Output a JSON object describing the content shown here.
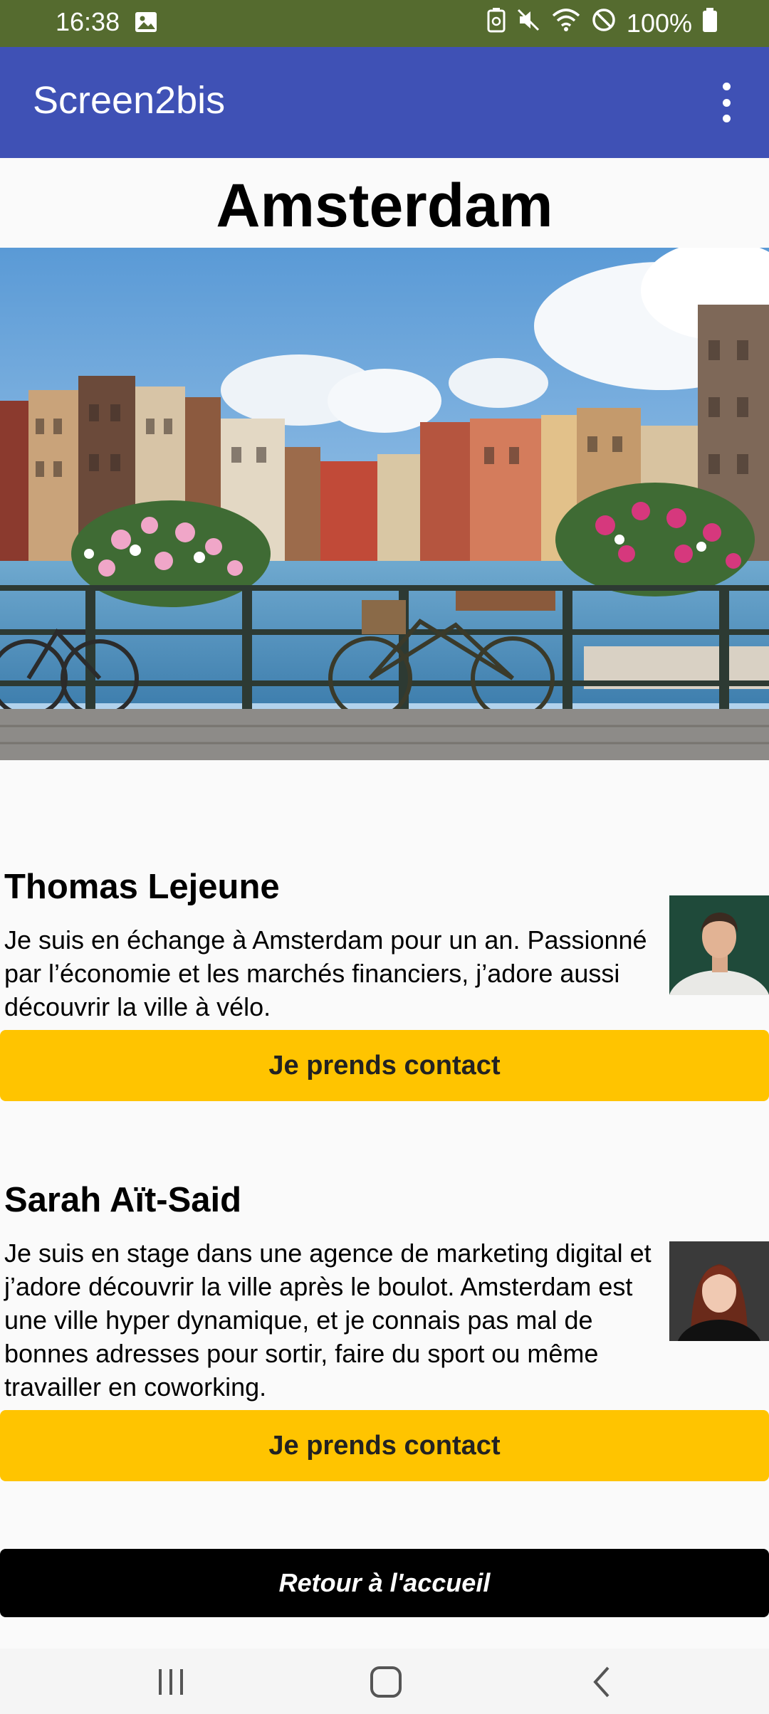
{
  "status_bar": {
    "time": "16:38",
    "battery": "100%",
    "icons": [
      "image-icon",
      "battery-saver-icon",
      "mute-icon",
      "wifi-icon",
      "do-not-disturb-icon",
      "battery-icon"
    ]
  },
  "app_bar": {
    "title": "Screen2bis",
    "menu_icon": "overflow-menu-icon"
  },
  "page": {
    "city": "Amsterdam"
  },
  "profiles": [
    {
      "name": "Thomas Lejeune",
      "description": "Je suis en échange à Amsterdam pour un an. Passionné par l’économie et les marchés financiers, j’adore aussi découvrir la ville à vélo.",
      "button": "Je prends contact"
    },
    {
      "name": "Sarah Aït-Said",
      "description": "Je suis en stage dans une agence de marketing digital et j’adore découvrir la ville après le boulot. Amsterdam est une ville hyper dynamique, et je connais pas mal de bonnes adresses pour sortir, faire du sport ou même travailler en coworking.",
      "button": "Je prends contact"
    }
  ],
  "footer": {
    "home_button": "Retour à l'accueil"
  },
  "nav_bar": {
    "icons": [
      "recent-apps-icon",
      "home-icon",
      "back-icon"
    ]
  },
  "colors": {
    "status_bar": "#556b2f",
    "app_bar": "#3f51b5",
    "contact_button": "#ffc400",
    "home_button": "#000000"
  }
}
